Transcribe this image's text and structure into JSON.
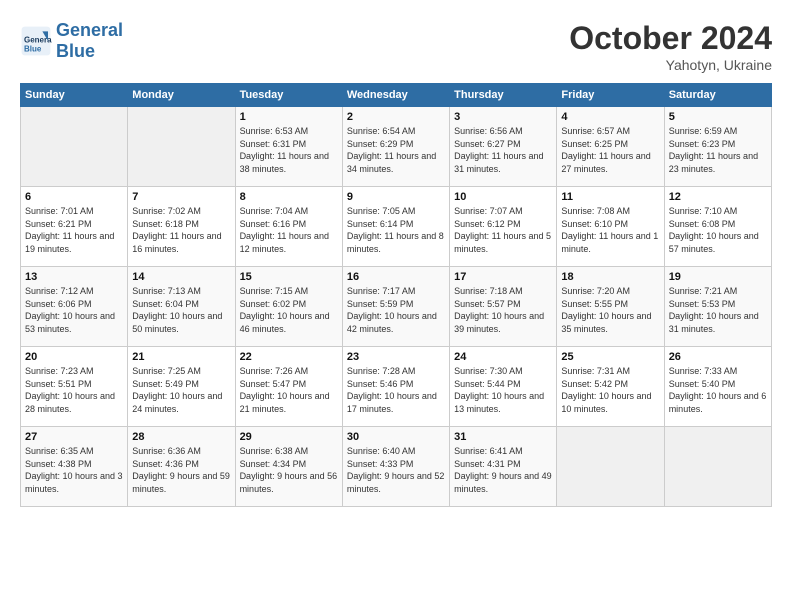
{
  "header": {
    "logo_general": "General",
    "logo_blue": "Blue",
    "month": "October 2024",
    "location": "Yahotyn, Ukraine"
  },
  "days_of_week": [
    "Sunday",
    "Monday",
    "Tuesday",
    "Wednesday",
    "Thursday",
    "Friday",
    "Saturday"
  ],
  "weeks": [
    [
      {
        "day": "",
        "sunrise": "",
        "sunset": "",
        "daylight": ""
      },
      {
        "day": "",
        "sunrise": "",
        "sunset": "",
        "daylight": ""
      },
      {
        "day": "1",
        "sunrise": "Sunrise: 6:53 AM",
        "sunset": "Sunset: 6:31 PM",
        "daylight": "Daylight: 11 hours and 38 minutes."
      },
      {
        "day": "2",
        "sunrise": "Sunrise: 6:54 AM",
        "sunset": "Sunset: 6:29 PM",
        "daylight": "Daylight: 11 hours and 34 minutes."
      },
      {
        "day": "3",
        "sunrise": "Sunrise: 6:56 AM",
        "sunset": "Sunset: 6:27 PM",
        "daylight": "Daylight: 11 hours and 31 minutes."
      },
      {
        "day": "4",
        "sunrise": "Sunrise: 6:57 AM",
        "sunset": "Sunset: 6:25 PM",
        "daylight": "Daylight: 11 hours and 27 minutes."
      },
      {
        "day": "5",
        "sunrise": "Sunrise: 6:59 AM",
        "sunset": "Sunset: 6:23 PM",
        "daylight": "Daylight: 11 hours and 23 minutes."
      }
    ],
    [
      {
        "day": "6",
        "sunrise": "Sunrise: 7:01 AM",
        "sunset": "Sunset: 6:21 PM",
        "daylight": "Daylight: 11 hours and 19 minutes."
      },
      {
        "day": "7",
        "sunrise": "Sunrise: 7:02 AM",
        "sunset": "Sunset: 6:18 PM",
        "daylight": "Daylight: 11 hours and 16 minutes."
      },
      {
        "day": "8",
        "sunrise": "Sunrise: 7:04 AM",
        "sunset": "Sunset: 6:16 PM",
        "daylight": "Daylight: 11 hours and 12 minutes."
      },
      {
        "day": "9",
        "sunrise": "Sunrise: 7:05 AM",
        "sunset": "Sunset: 6:14 PM",
        "daylight": "Daylight: 11 hours and 8 minutes."
      },
      {
        "day": "10",
        "sunrise": "Sunrise: 7:07 AM",
        "sunset": "Sunset: 6:12 PM",
        "daylight": "Daylight: 11 hours and 5 minutes."
      },
      {
        "day": "11",
        "sunrise": "Sunrise: 7:08 AM",
        "sunset": "Sunset: 6:10 PM",
        "daylight": "Daylight: 11 hours and 1 minute."
      },
      {
        "day": "12",
        "sunrise": "Sunrise: 7:10 AM",
        "sunset": "Sunset: 6:08 PM",
        "daylight": "Daylight: 10 hours and 57 minutes."
      }
    ],
    [
      {
        "day": "13",
        "sunrise": "Sunrise: 7:12 AM",
        "sunset": "Sunset: 6:06 PM",
        "daylight": "Daylight: 10 hours and 53 minutes."
      },
      {
        "day": "14",
        "sunrise": "Sunrise: 7:13 AM",
        "sunset": "Sunset: 6:04 PM",
        "daylight": "Daylight: 10 hours and 50 minutes."
      },
      {
        "day": "15",
        "sunrise": "Sunrise: 7:15 AM",
        "sunset": "Sunset: 6:02 PM",
        "daylight": "Daylight: 10 hours and 46 minutes."
      },
      {
        "day": "16",
        "sunrise": "Sunrise: 7:17 AM",
        "sunset": "Sunset: 5:59 PM",
        "daylight": "Daylight: 10 hours and 42 minutes."
      },
      {
        "day": "17",
        "sunrise": "Sunrise: 7:18 AM",
        "sunset": "Sunset: 5:57 PM",
        "daylight": "Daylight: 10 hours and 39 minutes."
      },
      {
        "day": "18",
        "sunrise": "Sunrise: 7:20 AM",
        "sunset": "Sunset: 5:55 PM",
        "daylight": "Daylight: 10 hours and 35 minutes."
      },
      {
        "day": "19",
        "sunrise": "Sunrise: 7:21 AM",
        "sunset": "Sunset: 5:53 PM",
        "daylight": "Daylight: 10 hours and 31 minutes."
      }
    ],
    [
      {
        "day": "20",
        "sunrise": "Sunrise: 7:23 AM",
        "sunset": "Sunset: 5:51 PM",
        "daylight": "Daylight: 10 hours and 28 minutes."
      },
      {
        "day": "21",
        "sunrise": "Sunrise: 7:25 AM",
        "sunset": "Sunset: 5:49 PM",
        "daylight": "Daylight: 10 hours and 24 minutes."
      },
      {
        "day": "22",
        "sunrise": "Sunrise: 7:26 AM",
        "sunset": "Sunset: 5:47 PM",
        "daylight": "Daylight: 10 hours and 21 minutes."
      },
      {
        "day": "23",
        "sunrise": "Sunrise: 7:28 AM",
        "sunset": "Sunset: 5:46 PM",
        "daylight": "Daylight: 10 hours and 17 minutes."
      },
      {
        "day": "24",
        "sunrise": "Sunrise: 7:30 AM",
        "sunset": "Sunset: 5:44 PM",
        "daylight": "Daylight: 10 hours and 13 minutes."
      },
      {
        "day": "25",
        "sunrise": "Sunrise: 7:31 AM",
        "sunset": "Sunset: 5:42 PM",
        "daylight": "Daylight: 10 hours and 10 minutes."
      },
      {
        "day": "26",
        "sunrise": "Sunrise: 7:33 AM",
        "sunset": "Sunset: 5:40 PM",
        "daylight": "Daylight: 10 hours and 6 minutes."
      }
    ],
    [
      {
        "day": "27",
        "sunrise": "Sunrise: 6:35 AM",
        "sunset": "Sunset: 4:38 PM",
        "daylight": "Daylight: 10 hours and 3 minutes."
      },
      {
        "day": "28",
        "sunrise": "Sunrise: 6:36 AM",
        "sunset": "Sunset: 4:36 PM",
        "daylight": "Daylight: 9 hours and 59 minutes."
      },
      {
        "day": "29",
        "sunrise": "Sunrise: 6:38 AM",
        "sunset": "Sunset: 4:34 PM",
        "daylight": "Daylight: 9 hours and 56 minutes."
      },
      {
        "day": "30",
        "sunrise": "Sunrise: 6:40 AM",
        "sunset": "Sunset: 4:33 PM",
        "daylight": "Daylight: 9 hours and 52 minutes."
      },
      {
        "day": "31",
        "sunrise": "Sunrise: 6:41 AM",
        "sunset": "Sunset: 4:31 PM",
        "daylight": "Daylight: 9 hours and 49 minutes."
      },
      {
        "day": "",
        "sunrise": "",
        "sunset": "",
        "daylight": ""
      },
      {
        "day": "",
        "sunrise": "",
        "sunset": "",
        "daylight": ""
      }
    ]
  ]
}
